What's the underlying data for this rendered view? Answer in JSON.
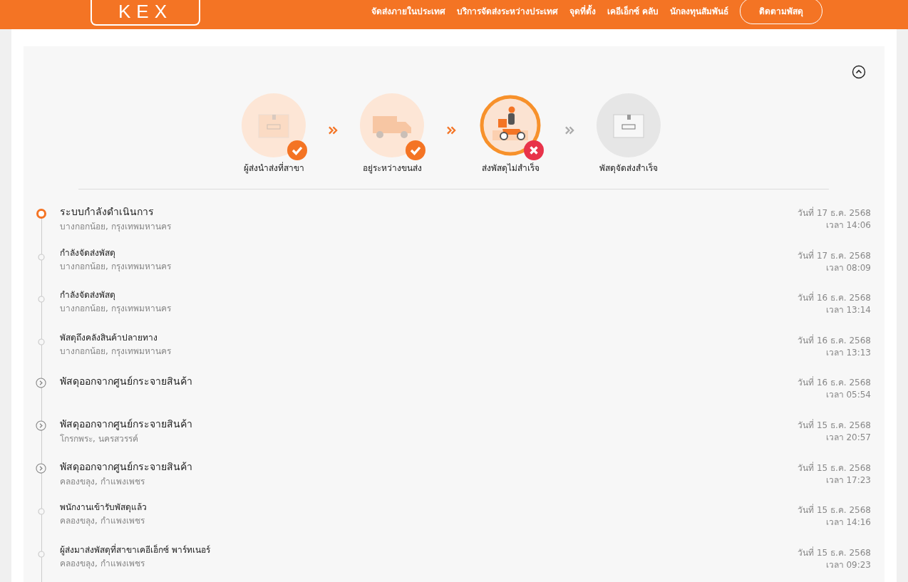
{
  "header": {
    "logo": "KEX",
    "nav": [
      "จัดส่งภายในประเทศ",
      "บริการจัดส่งระหว่างประเทศ",
      "จุดที่ตั้ง",
      "เคอีเอ็กซ์ คลับ",
      "นักลงทุนสัมพันธ์"
    ],
    "track_button": "ติดตามพัสดุ"
  },
  "progress": {
    "expanded": true,
    "steps": [
      {
        "label": "ผู้ส่งนำส่งที่สาขา",
        "completed": true,
        "failed": false,
        "kind": "box"
      },
      {
        "label": "อยู่ระหว่างขนส่ง",
        "completed": true,
        "failed": false,
        "kind": "truck"
      },
      {
        "label": "ส่งพัสดุไม่สำเร็จ",
        "completed": false,
        "failed": true,
        "kind": "scooter"
      },
      {
        "label": "พัสดุจัดส่งสำเร็จ",
        "completed": false,
        "failed": false,
        "kind": "box"
      }
    ]
  },
  "events": [
    {
      "kind": "current",
      "title": "ระบบกำลังดำเนินการ",
      "place": "บางกอกน้อย, กรุงเทพมหานคร",
      "date": "วันที่ 17 ธ.ค. 2568",
      "time": "เวลา 14:06"
    },
    {
      "kind": "dot",
      "title": "กำลังจัดส่งพัสดุ",
      "place": "บางกอกน้อย, กรุงเทพมหานคร",
      "date": "วันที่ 17 ธ.ค. 2568",
      "time": "เวลา 08:09"
    },
    {
      "kind": "dot",
      "title": "กำลังจัดส่งพัสดุ",
      "place": "บางกอกน้อย, กรุงเทพมหานคร",
      "date": "วันที่ 16 ธ.ค. 2568",
      "time": "เวลา 13:14"
    },
    {
      "kind": "dot",
      "title": "พัสดุถึงคลังสินค้าปลายทาง",
      "place": "บางกอกน้อย, กรุงเทพมหานคร",
      "date": "วันที่ 16 ธ.ค. 2568",
      "time": "เวลา 13:13"
    },
    {
      "kind": "hub",
      "title": "พัสดุออกจากศูนย์กระจายสินค้า",
      "date": "วันที่ 16 ธ.ค. 2568",
      "time": "เวลา 05:54"
    },
    {
      "kind": "hub",
      "title": "พัสดุออกจากศูนย์กระจายสินค้า",
      "place": "โกรกพระ, นครสวรรค์",
      "date": "วันที่ 15 ธ.ค. 2568",
      "time": "เวลา 20:57"
    },
    {
      "kind": "hub",
      "title": "พัสดุออกจากศูนย์กระจายสินค้า",
      "place": "คลองขลุง, กำแพงเพชร",
      "date": "วันที่ 15 ธ.ค. 2568",
      "time": "เวลา 17:23"
    },
    {
      "kind": "dot",
      "title": "พนักงานเข้ารับพัสดุแล้ว",
      "place": "คลองขลุง, กำแพงเพชร",
      "date": "วันที่ 15 ธ.ค. 2568",
      "time": "เวลา 14:16"
    },
    {
      "kind": "dot",
      "title": "ผู้ส่งมาส่งพัสดุที่สาขาเคอีเอ็กซ์ พาร์ทเนอร์",
      "place": "คลองขลุง, กำแพงเพชร",
      "date": "วันที่ 15 ธ.ค. 2568",
      "time": "เวลา 09:23"
    }
  ]
}
